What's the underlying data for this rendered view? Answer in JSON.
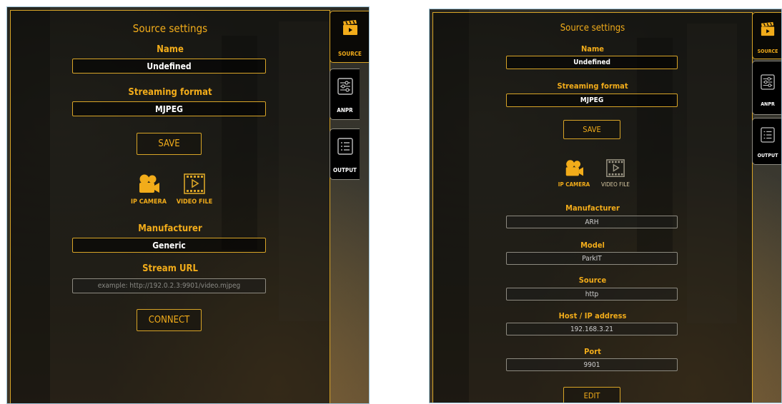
{
  "left": {
    "panel_title": "Source settings",
    "name_label": "Name",
    "name_value": "Undefined",
    "format_label": "Streaming format",
    "format_value": "MJPEG",
    "save_label": "SAVE",
    "ip_camera_label": "IP CAMERA",
    "video_file_label": "VIDEO FILE",
    "manufacturer_label": "Manufacturer",
    "manufacturer_value": "Generic",
    "stream_url_label": "Stream URL",
    "stream_url_placeholder": "example: http://192.0.2.3:9901/video.mjpeg",
    "connect_label": "CONNECT",
    "tabs": {
      "source": "SOURCE",
      "anpr": "ANPR",
      "output": "OUTPUT"
    }
  },
  "right": {
    "panel_title": "Source settings",
    "name_label": "Name",
    "name_value": "Undefined",
    "format_label": "Streaming format",
    "format_value": "MJPEG",
    "save_label": "SAVE",
    "ip_camera_label": "IP CAMERA",
    "video_file_label": "VIDEO FILE",
    "manufacturer_label": "Manufacturer",
    "manufacturer_value": "ARH",
    "model_label": "Model",
    "model_value": "ParkIT",
    "source_label": "Source",
    "source_value": "http",
    "host_label": "Host / IP address",
    "host_value": "192.168.3.21",
    "port_label": "Port",
    "port_value": "9901",
    "edit_label": "EDIT",
    "tabs": {
      "source": "SOURCE",
      "anpr": "ANPR",
      "output": "OUTPUT"
    }
  },
  "theme": {
    "accent": "#f2ac1a",
    "border_accent": "#d8a427",
    "panel_bg": "#080806"
  },
  "icons": [
    "ip-camera-icon",
    "video-file-icon",
    "source-clapperboard-icon",
    "anpr-sliders-icon",
    "output-list-icon"
  ]
}
